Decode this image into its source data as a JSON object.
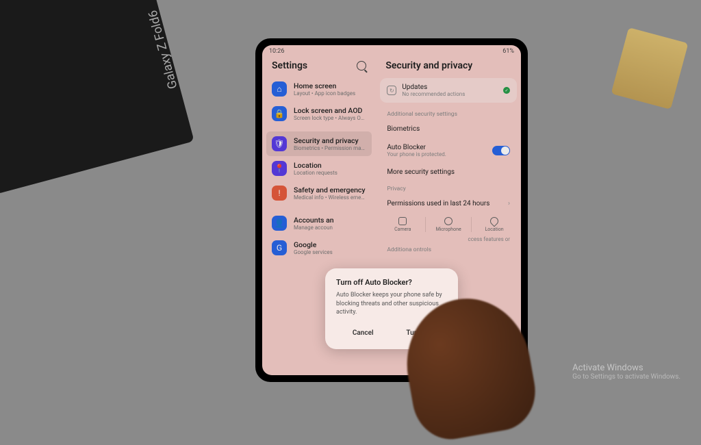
{
  "box_text": "Galaxy Z Fold6",
  "status": {
    "time": "10:26",
    "battery": "61%"
  },
  "left": {
    "title": "Settings",
    "items": [
      {
        "title": "Home screen",
        "sub": "Layout • App icon badges",
        "color": "#2966e8",
        "glyph": "⌂"
      },
      {
        "title": "Lock screen and AOD",
        "sub": "Screen lock type • Always On Display",
        "color": "#2966e8",
        "glyph": "🔒"
      },
      {
        "title": "Security and privacy",
        "sub": "Biometrics • Permission manager",
        "color": "#5b3de8",
        "glyph": "🛡",
        "selected": true
      },
      {
        "title": "Location",
        "sub": "Location requests",
        "color": "#5b3de8",
        "glyph": "📍"
      },
      {
        "title": "Safety and emergency",
        "sub": "Medical info • Wireless emergency alerts",
        "color": "#e85c3d",
        "glyph": "!"
      },
      {
        "title": "Accounts an",
        "sub": "Manage accoun",
        "color": "#2966e8",
        "glyph": "👤"
      },
      {
        "title": "Google",
        "sub": "Google services",
        "color": "#2966e8",
        "glyph": "G"
      }
    ]
  },
  "right": {
    "title": "Security and privacy",
    "updates": {
      "title": "Updates",
      "sub": "No recommended actions"
    },
    "section1": "Additional security settings",
    "biometrics": "Biometrics",
    "autoblocker": {
      "title": "Auto Blocker",
      "sub": "Your phone is protected."
    },
    "more": "More security settings",
    "section2": "Privacy",
    "permissions": "Permissions used in last 24 hours",
    "perm_types": [
      "Camera",
      "Microphone",
      "Location"
    ],
    "additional": "Additiona              ontrols",
    "hidden_text": "ccess features or"
  },
  "dialog": {
    "title": "Turn off Auto Blocker?",
    "body": "Auto Blocker keeps your phone safe by blocking threats and other suspicious activity.",
    "cancel": "Cancel",
    "confirm": "Turn off"
  },
  "watermark": {
    "line1": "Activate Windows",
    "line2": "Go to Settings to activate Windows."
  }
}
